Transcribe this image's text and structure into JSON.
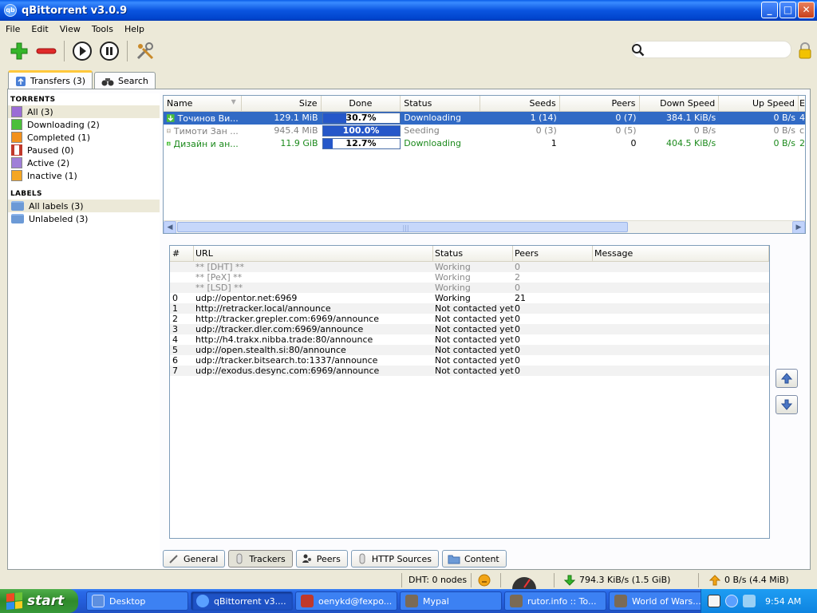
{
  "window": {
    "title": "qBittorrent v3.0.9",
    "icon_label": "qb",
    "minimize": "_",
    "maximize": "□",
    "close": "✕"
  },
  "menu": [
    "File",
    "Edit",
    "View",
    "Tools",
    "Help"
  ],
  "search": {
    "value": "",
    "placeholder": ""
  },
  "tabs": {
    "transfers": "Transfers (3)",
    "search": "Search"
  },
  "sidebar": {
    "torrents_heading": "Torrents",
    "filters": [
      {
        "label": "All (3)",
        "color": "#9b6dd6"
      },
      {
        "label": "Downloading (2)",
        "color": "#4bbf3a"
      },
      {
        "label": "Completed (1)",
        "color": "#f2901c"
      },
      {
        "label": "Paused (0)",
        "color": "#c0392b"
      },
      {
        "label": "Active (2)",
        "color": "#a07fd8"
      },
      {
        "label": "Inactive (1)",
        "color": "#f5a623"
      }
    ],
    "labels_heading": "Labels",
    "labels": [
      "All labels (3)",
      "Unlabeled (3)"
    ]
  },
  "torrent_columns": [
    "Name",
    "Size",
    "Done",
    "Status",
    "Seeds",
    "Peers",
    "Down Speed",
    "Up Speed",
    "E"
  ],
  "torrents": [
    {
      "name": "Точинов Ви...",
      "size": "129.1 MiB",
      "done": "30.7%",
      "progress": 0.307,
      "status": "Downloading",
      "seeds": "1 (14)",
      "peers": "0 (7)",
      "down": "384.1 KiB/s",
      "up": "0 B/s",
      "eta": "4"
    },
    {
      "name": "Тимоти Зан ...",
      "size": "945.4 MiB",
      "done": "100.0%",
      "progress": 1.0,
      "status": "Seeding",
      "seeds": "0 (3)",
      "peers": "0 (5)",
      "down": "0 B/s",
      "up": "0 B/s",
      "eta": "c"
    },
    {
      "name": "Дизайн и ан...",
      "size": "11.9 GiB",
      "done": "12.7%",
      "progress": 0.127,
      "status": "Downloading",
      "seeds": "1",
      "peers": "0",
      "down": "404.5 KiB/s",
      "up": "0 B/s",
      "eta": "2"
    }
  ],
  "tracker_columns": [
    "#",
    "URL",
    "Status",
    "Peers",
    "Message"
  ],
  "trackers": [
    {
      "num": "",
      "url": "** [DHT] **",
      "status": "Working",
      "peers": "0",
      "meta": true
    },
    {
      "num": "",
      "url": "** [PeX] **",
      "status": "Working",
      "peers": "2",
      "meta": true
    },
    {
      "num": "",
      "url": "** [LSD] **",
      "status": "Working",
      "peers": "0",
      "meta": true
    },
    {
      "num": "0",
      "url": "udp://opentor.net:6969",
      "status": "Working",
      "peers": "21",
      "meta": false
    },
    {
      "num": "1",
      "url": "http://retracker.local/announce",
      "status": "Not contacted yet",
      "peers": "0",
      "meta": false
    },
    {
      "num": "2",
      "url": "http://tracker.grepler.com:6969/announce",
      "status": "Not contacted yet",
      "peers": "0",
      "meta": false
    },
    {
      "num": "3",
      "url": "udp://tracker.dler.com:6969/announce",
      "status": "Not contacted yet",
      "peers": "0",
      "meta": false
    },
    {
      "num": "4",
      "url": "http://h4.trakx.nibba.trade:80/announce",
      "status": "Not contacted yet",
      "peers": "0",
      "meta": false
    },
    {
      "num": "5",
      "url": "udp://open.stealth.si:80/announce",
      "status": "Not contacted yet",
      "peers": "0",
      "meta": false
    },
    {
      "num": "6",
      "url": "udp://tracker.bitsearch.to:1337/announce",
      "status": "Not contacted yet",
      "peers": "0",
      "meta": false
    },
    {
      "num": "7",
      "url": "udp://exodus.desync.com:6969/announce",
      "status": "Not contacted yet",
      "peers": "0",
      "meta": false
    }
  ],
  "bottom_tabs": [
    "General",
    "Trackers",
    "Peers",
    "HTTP Sources",
    "Content"
  ],
  "statusbar": {
    "dht": "DHT: 0 nodes",
    "down": "794.3 KiB/s (1.5 GiB)",
    "up": "0 B/s (4.4 MiB)"
  },
  "taskbar": {
    "start": "start",
    "items": [
      {
        "label": "Desktop",
        "icon_color": "#5d8fe0"
      },
      {
        "label": "qBittorrent v3....",
        "icon_color": "#5aa0ff",
        "active": true
      },
      {
        "label": "oenykd@fexpo...",
        "icon_color": "#c0392b"
      },
      {
        "label": "Mypal",
        "icon_color": "#7a6a55"
      },
      {
        "label": "rutor.info :: To...",
        "icon_color": "#7a6a55"
      },
      {
        "label": "World of Wars...",
        "icon_color": "#7a6a55"
      }
    ],
    "clock": "9:54 AM"
  },
  "colors": {
    "selection": "#316ac5",
    "downloading_text": "#1c8a1c",
    "progress_fill": "#2557c9"
  }
}
